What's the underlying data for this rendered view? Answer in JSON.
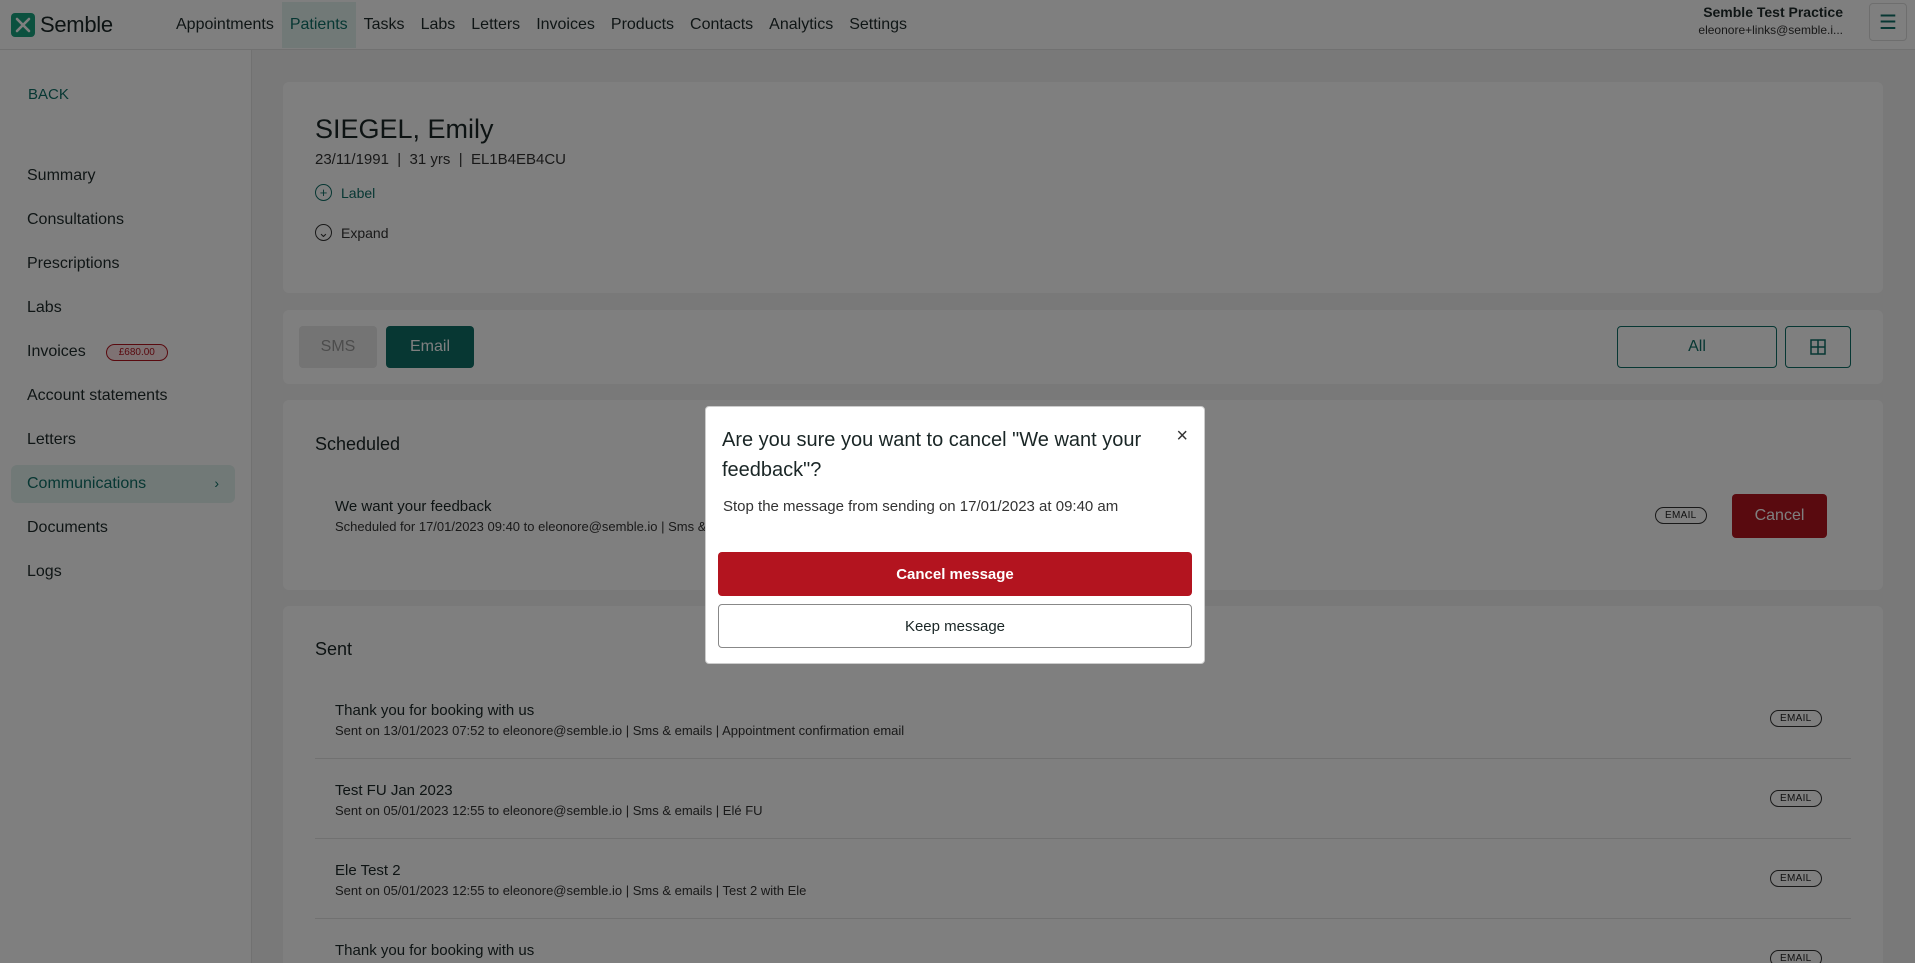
{
  "app": {
    "name": "Semble"
  },
  "nav": {
    "items": [
      "Appointments",
      "Patients",
      "Tasks",
      "Labs",
      "Letters",
      "Invoices",
      "Products",
      "Contacts",
      "Analytics",
      "Settings"
    ],
    "active": "Patients"
  },
  "account": {
    "practice": "Semble Test Practice",
    "email": "eleonore+links@semble.i..."
  },
  "sidebar": {
    "back": "BACK",
    "items": [
      {
        "label": "Summary"
      },
      {
        "label": "Consultations"
      },
      {
        "label": "Prescriptions"
      },
      {
        "label": "Labs"
      },
      {
        "label": "Invoices",
        "badge": "£680.00"
      },
      {
        "label": "Account statements"
      },
      {
        "label": "Letters"
      },
      {
        "label": "Communications"
      },
      {
        "label": "Documents"
      },
      {
        "label": "Logs"
      }
    ],
    "active": "Communications"
  },
  "patient": {
    "name": "SIEGEL, Emily",
    "meta": "23/11/1991  |  31 yrs  |  EL1B4EB4CU",
    "label_link": "Label",
    "expand_link": "Expand"
  },
  "tabs": {
    "sms": "SMS",
    "email": "Email",
    "active": "Email",
    "filter": "All"
  },
  "scheduled": {
    "title": "Scheduled",
    "items": [
      {
        "title": "We want your feedback",
        "subtitle": "Scheduled for 17/01/2023 09:40 to eleonore@semble.io | Sms &",
        "tag": "EMAIL",
        "action": "Cancel"
      }
    ]
  },
  "sent": {
    "title": "Sent",
    "items": [
      {
        "title": "Thank you for booking with us",
        "subtitle": "Sent on 13/01/2023 07:52 to eleonore@semble.io | Sms & emails | Appointment confirmation email",
        "tag": "EMAIL"
      },
      {
        "title": "Test FU Jan 2023",
        "subtitle": "Sent on 05/01/2023 12:55 to eleonore@semble.io | Sms & emails | Elé FU",
        "tag": "EMAIL"
      },
      {
        "title": "Ele Test 2",
        "subtitle": "Sent on 05/01/2023 12:55 to eleonore@semble.io | Sms & emails | Test 2 with Ele",
        "tag": "EMAIL"
      },
      {
        "title": "Thank you for booking with us",
        "subtitle": "",
        "tag": "EMAIL"
      }
    ]
  },
  "modal": {
    "title": "Are you sure you want to cancel \"We want your feedback\"?",
    "body": "Stop the message from sending on 17/01/2023 at 09:40 am",
    "confirm": "Cancel message",
    "keep": "Keep message",
    "close": "×"
  },
  "colors": {
    "brand": "#0e6e66",
    "danger": "#b3141f",
    "active_bg": "#e3f3ee"
  }
}
